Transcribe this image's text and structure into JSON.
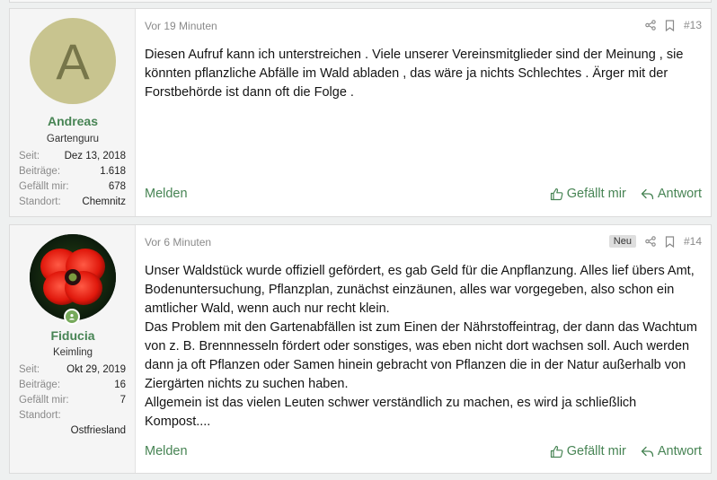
{
  "posts": [
    {
      "avatar_letter": "A",
      "username": "Andreas",
      "user_title": "Gartenguru",
      "stats": [
        {
          "label": "Seit:",
          "value": "Dez 13, 2018"
        },
        {
          "label": "Beiträge:",
          "value": "1.618"
        },
        {
          "label": "Gefällt mir:",
          "value": "678"
        },
        {
          "label": "Standort:",
          "value": "Chemnitz"
        }
      ],
      "time": "Vor 19 Minuten",
      "number": "#13",
      "badge": "",
      "paragraphs": [
        "Diesen Aufruf kann ich unterstreichen . Viele unserer Vereinsmitglieder sind der Meinung , sie könnten pflanzliche Abfälle im Wald abladen , das wäre ja nichts Schlechtes . Ärger mit der Forstbehörde ist dann oft die Folge ."
      ],
      "report_label": "Melden",
      "like_label": "Gefällt mir",
      "reply_label": "Antwort"
    },
    {
      "username": "Fiducia",
      "user_title": "Keimling",
      "stats": [
        {
          "label": "Seit:",
          "value": "Okt 29, 2019"
        },
        {
          "label": "Beiträge:",
          "value": "16"
        },
        {
          "label": "Gefällt mir:",
          "value": "7"
        },
        {
          "label": "Standort:",
          "value": "Ostfriesland"
        }
      ],
      "time": "Vor 6 Minuten",
      "number": "#14",
      "badge": "Neu",
      "paragraphs": [
        "Unser Waldstück wurde offiziell gefördert, es gab Geld für die Anpflanzung. Alles lief übers Amt, Bodenuntersuchung, Pflanzplan, zunächst einzäunen, alles war vorgegeben, also schon ein amtlicher Wald, wenn auch nur recht klein.",
        "Das Problem mit den Gartenabfällen ist zum Einen der Nährstoffeintrag, der dann das Wachtum von z. B. Brennnesseln fördert oder sonstiges, was eben nicht dort wachsen soll. Auch werden dann ja oft Pflanzen oder Samen hinein gebracht von Pflanzen die in der Natur außerhalb von Ziergärten nichts zu suchen haben.",
        "Allgemein ist das vielen Leuten schwer verständlich zu machen, es wird ja schließlich Kompost...."
      ],
      "report_label": "Melden",
      "like_label": "Gefällt mir",
      "reply_label": "Antwort"
    }
  ]
}
